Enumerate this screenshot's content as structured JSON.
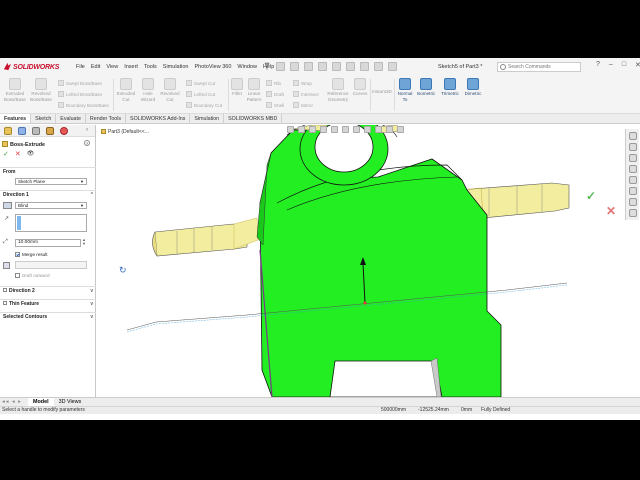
{
  "app": {
    "logo_text": "SOLIDWORKS",
    "menus": [
      "File",
      "Edit",
      "View",
      "Insert",
      "Tools",
      "Simulation",
      "PhotoView 360",
      "Window",
      "Help"
    ],
    "document_title": "Sketch5 of Part3 *",
    "search_placeholder": "Search Commands",
    "window_controls": [
      "?",
      "–",
      "□",
      "✕"
    ]
  },
  "commands": {
    "extruded_boss": "Extruded Boss/Base",
    "revolved_boss": "Revolved Boss/Base",
    "swept_boss": "Swept Boss/Base",
    "lofted_boss": "Lofted Boss/Base",
    "boundary_boss": "Boundary Boss/Base",
    "extruded_cut": "Extruded Cut",
    "hole_wizard": "Hole Wizard",
    "revolved_cut": "Revolved Cut",
    "swept_cut": "Swept Cut",
    "lofted_cut": "Lofted Cut",
    "boundary_cut": "Boundary Cut",
    "fillet": "Fillet",
    "linear_pattern": "Linear Pattern",
    "rib": "Rib",
    "draft": "Draft",
    "shell": "Shell",
    "wrap": "Wrap",
    "intersect": "Intersect",
    "mirror": "Mirror",
    "reference_geometry": "Reference Geometry",
    "curves": "Curves",
    "instant3d": "Instant3D",
    "normal_to": "Normal To",
    "isometric": "Isometric",
    "trimetric": "Trimetric",
    "dimetric": "Dimetric"
  },
  "tabs": [
    "Features",
    "Sketch",
    "Evaluate",
    "Render Tools",
    "SOLIDWORKS Add-Ins",
    "Simulation",
    "SOLIDWORKS MBD"
  ],
  "active_tab": "Features",
  "property_manager": {
    "title": "Boss-Extrude",
    "from_label": "From",
    "from_value": "Sketch Plane",
    "direction1_label": "Direction 1",
    "end_condition": "Blind",
    "depth_value": "10.00mm",
    "merge_result_label": "Merge result",
    "merge_result_checked": true,
    "draft_outward_label": "Draft outward",
    "direction2_label": "Direction 2",
    "thin_feature_label": "Thin Feature",
    "selected_contours_label": "Selected Contours"
  },
  "viewport": {
    "tree_item": "Part3  (Default<<...",
    "model_color": "#22ee22",
    "tab_color": "#f3eda0"
  },
  "bottom_tabs": [
    "Model",
    "3D Views"
  ],
  "active_bottom_tab": "Model",
  "status": {
    "message": "Select a handle to modify parameters",
    "x": "500000mm",
    "y": "-12525.24mm",
    "z": "0mm",
    "state": "Fully Defined"
  }
}
